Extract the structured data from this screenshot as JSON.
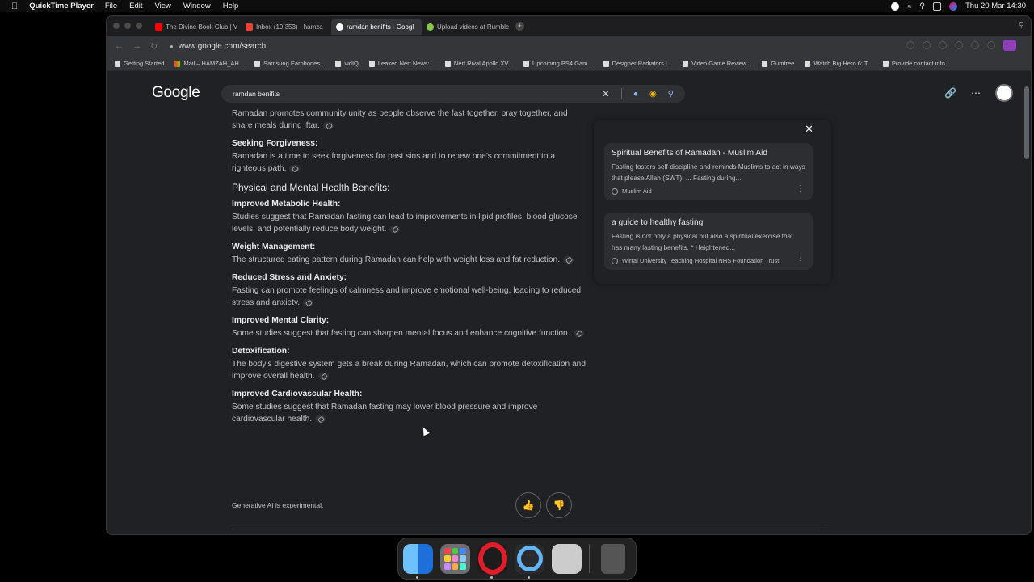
{
  "menubar": {
    "app": "QuickTime Player",
    "items": [
      "File",
      "Edit",
      "View",
      "Window",
      "Help"
    ],
    "clock": "Thu 20 Mar  14:30"
  },
  "browser": {
    "tabs": [
      {
        "label": "The Divine Book Club | V",
        "color": "#ff0000"
      },
      {
        "label": "Inbox (19,353) - hamza",
        "color": "#ea4335"
      },
      {
        "label": "ramdan benifits - Googl",
        "color": "#4285f4"
      },
      {
        "label": "Upload videos at Rumble",
        "color": "#85c742"
      }
    ],
    "url": "www.google.com/search",
    "bookmarks": [
      "Getting Started",
      "Mail – HAMZAH_AH...",
      "Samsung Earphones...",
      "vidIQ",
      "Leaked Nerf News:...",
      "Nerf Rival Apollo XV...",
      "Upcoming PS4 Gam...",
      "Designer Radiators |...",
      "Video Game Review...",
      "Gumtree",
      "Watch Big Hero 6: T...",
      "Provide contact info"
    ]
  },
  "google": {
    "logo": "Google",
    "query": "ramdan benifits"
  },
  "content": {
    "intro": "Ramadan promotes community unity as people observe the fast together, pray together, and share meals during iftar.",
    "forgiveness_title": "Seeking Forgiveness:",
    "forgiveness_text": "Ramadan is a time to seek forgiveness for past sins and to renew one's commitment to a righteous path.",
    "section_title": "Physical and Mental Health Benefits:",
    "items": [
      {
        "title": "Improved Metabolic Health:",
        "text": "Studies suggest that Ramadan fasting can lead to improvements in lipid profiles, blood glucose levels, and potentially reduce body weight."
      },
      {
        "title": "Weight Management:",
        "text": "The structured eating pattern during Ramadan can help with weight loss and fat reduction."
      },
      {
        "title": "Reduced Stress and Anxiety:",
        "text": "Fasting can promote feelings of calmness and improve emotional well-being, leading to reduced stress and anxiety."
      },
      {
        "title": "Improved Mental Clarity:",
        "text": "Some studies suggest that fasting can sharpen mental focus and enhance cognitive function."
      },
      {
        "title": "Detoxification:",
        "text": "The body's digestive system gets a break during Ramadan, which can promote detoxification and improve overall health."
      },
      {
        "title": "Improved Cardiovascular Health:",
        "text": "Some studies suggest that Ramadan fasting may lower blood pressure and improve cardiovascular health."
      }
    ],
    "experimental": "Generative AI is experimental."
  },
  "sources": [
    {
      "title": "Spiritual Benefits of Ramadan - Muslim Aid",
      "snippet": "Fasting fosters self-discipline and reminds Muslims to act in ways that please Allah (SWT). ... Fasting during...",
      "site": "Muslim Aid"
    },
    {
      "title": "a guide to healthy fasting",
      "snippet": "Fasting is not only a physical but also a spiritual exercise that has many lasting benefits. * Heightened...",
      "site": "Wirral University Teaching Hospital NHS Foundation Trust"
    }
  ]
}
